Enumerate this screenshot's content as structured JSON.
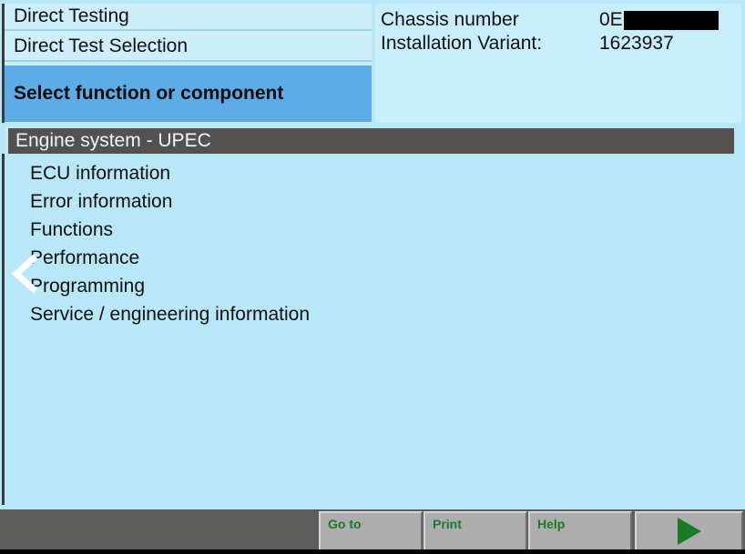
{
  "header": {
    "left_panel": {
      "title": "Direct Testing",
      "subtitle": "Direct Test Selection",
      "selected_prompt": "Select function or component"
    },
    "right_panel": {
      "chassis_label": "Chassis number",
      "chassis_value_prefix": "0E",
      "chassis_value_redacted": true,
      "variant_label": "Installation Variant:",
      "variant_value": "1623937"
    }
  },
  "list": {
    "group_header": "Engine system - UPEC",
    "items": [
      {
        "label": "ECU information"
      },
      {
        "label": "Error information"
      },
      {
        "label": "Functions"
      },
      {
        "label": "Performance"
      },
      {
        "label": "Programming"
      },
      {
        "label": "Service / engineering information"
      }
    ]
  },
  "cursor": {
    "icon": "chevron-left-icon"
  },
  "toolbar": {
    "goto_label": "Go to",
    "print_label": "Print",
    "help_label": "Help",
    "next_icon": "play-arrow-icon"
  },
  "colors": {
    "background": "#b8e8f8",
    "panel": "#c8eefb",
    "selected_blue": "#5cace8",
    "group_header_gray": "#545250",
    "toolbar_gray": "#5e5e5c",
    "button_gray": "#adadad",
    "accent_green": "#1a7a2a",
    "text": "#101010"
  }
}
